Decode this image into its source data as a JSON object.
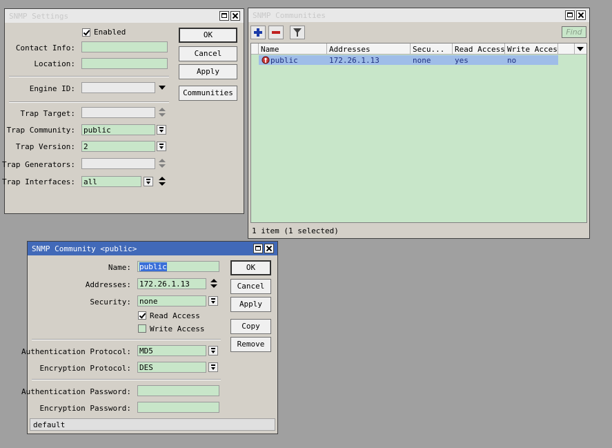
{
  "snmp_settings": {
    "title": "SNMP Settings",
    "enabled_label": "Enabled",
    "enabled": true,
    "contact_info_label": "Contact Info:",
    "contact_info_value": "",
    "location_label": "Location:",
    "location_value": "",
    "engine_id_label": "Engine ID:",
    "engine_id_value": "",
    "trap_target_label": "Trap Target:",
    "trap_target_value": "",
    "trap_community_label": "Trap Community:",
    "trap_community_value": "public",
    "trap_version_label": "Trap Version:",
    "trap_version_value": "2",
    "trap_generators_label": "Trap Generators:",
    "trap_generators_value": "",
    "trap_interfaces_label": "Trap Interfaces:",
    "trap_interfaces_value": "all",
    "buttons": {
      "ok": "OK",
      "cancel": "Cancel",
      "apply": "Apply",
      "communities": "Communities"
    }
  },
  "snmp_communities": {
    "title": "SNMP Communities",
    "find_label": "Find",
    "columns": [
      "Name",
      "Addresses",
      "Secu...",
      "Read Access",
      "Write Access"
    ],
    "rows": [
      {
        "name": "public",
        "addresses": "172.26.1.13",
        "security": "none",
        "read_access": "yes",
        "write_access": "no",
        "selected": true
      }
    ],
    "status": "1 item (1 selected)"
  },
  "snmp_community": {
    "title": "SNMP Community <public>",
    "name_label": "Name:",
    "name_value": "public",
    "addresses_label": "Addresses:",
    "addresses_value": "172.26.1.13",
    "security_label": "Security:",
    "security_value": "none",
    "read_access_label": "Read Access",
    "read_access": true,
    "write_access_label": "Write Access",
    "write_access": false,
    "auth_protocol_label": "Authentication Protocol:",
    "auth_protocol_value": "MD5",
    "enc_protocol_label": "Encryption Protocol:",
    "enc_protocol_value": "DES",
    "auth_password_label": "Authentication Password:",
    "auth_password_value": "",
    "enc_password_label": "Encryption Password:",
    "enc_password_value": "",
    "status": "default",
    "buttons": {
      "ok": "OK",
      "cancel": "Cancel",
      "apply": "Apply",
      "copy": "Copy",
      "remove": "Remove"
    }
  },
  "colors": {
    "field_bg": "#c8e6c9",
    "active_title": "#4169b8",
    "selected_row": "#9fbde8",
    "add_icon": "#1a3aa8",
    "remove_icon": "#c02020"
  },
  "icons": [
    "maximize-icon",
    "close-icon",
    "add-icon",
    "remove-icon",
    "filter-icon",
    "community-icon",
    "dropdown-icon",
    "spinner-icon"
  ]
}
